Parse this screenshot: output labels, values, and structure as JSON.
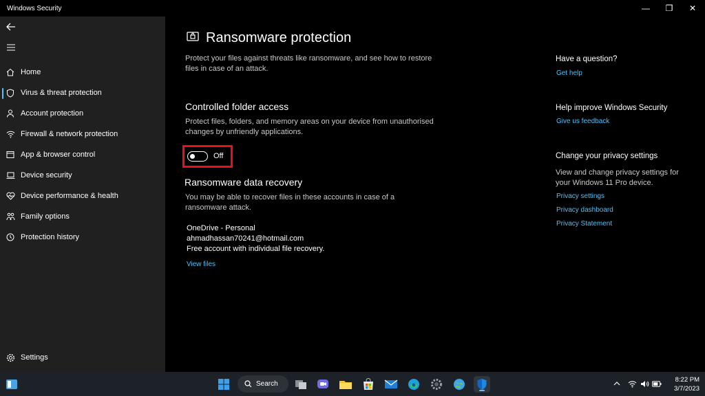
{
  "window": {
    "title": "Windows Security",
    "minimize": "—",
    "restore": "❐",
    "close": "✕"
  },
  "sidebar": {
    "back_icon": "back-arrow-icon",
    "menu_icon": "hamburger-menu-icon",
    "items": [
      {
        "label": "Home",
        "icon": "home-icon"
      },
      {
        "label": "Virus & threat protection",
        "icon": "shield-icon",
        "selected": true
      },
      {
        "label": "Account protection",
        "icon": "person-icon"
      },
      {
        "label": "Firewall & network protection",
        "icon": "wifi-icon"
      },
      {
        "label": "App & browser control",
        "icon": "app-window-icon"
      },
      {
        "label": "Device security",
        "icon": "laptop-icon"
      },
      {
        "label": "Device performance & health",
        "icon": "heart-icon"
      },
      {
        "label": "Family options",
        "icon": "family-icon"
      },
      {
        "label": "Protection history",
        "icon": "history-icon"
      }
    ],
    "settings_label": "Settings"
  },
  "main": {
    "title": "Ransomware protection",
    "description": "Protect your files against threats like ransomware, and see how to restore files in case of an attack.",
    "cfa": {
      "title": "Controlled folder access",
      "description": "Protect files, folders, and memory areas on your device from unauthorised changes by unfriendly applications.",
      "toggle_label": "Off",
      "toggle_on": false
    },
    "recovery": {
      "title": "Ransomware data recovery",
      "description": "You may be able to recover files in these accounts in case of a ransomware attack.",
      "account_name": "OneDrive - Personal",
      "account_email": "ahmadhassan70241@hotmail.com",
      "account_plan": "Free account with individual file recovery.",
      "view_files": "View files"
    }
  },
  "aside": {
    "question_title": "Have a question?",
    "get_help": "Get help",
    "improve_title": "Help improve Windows Security",
    "feedback": "Give us feedback",
    "privacy_title": "Change your privacy settings",
    "privacy_text": "View and change privacy settings for your Windows 11 Pro device.",
    "privacy_settings": "Privacy settings",
    "privacy_dashboard": "Privacy dashboard",
    "privacy_statement": "Privacy Statement"
  },
  "taskbar": {
    "search_label": "Search",
    "time": "8:22 PM",
    "date": "3/7/2023"
  },
  "colors": {
    "accent": "#4cc2ff",
    "highlight_box": "#e8101e"
  }
}
